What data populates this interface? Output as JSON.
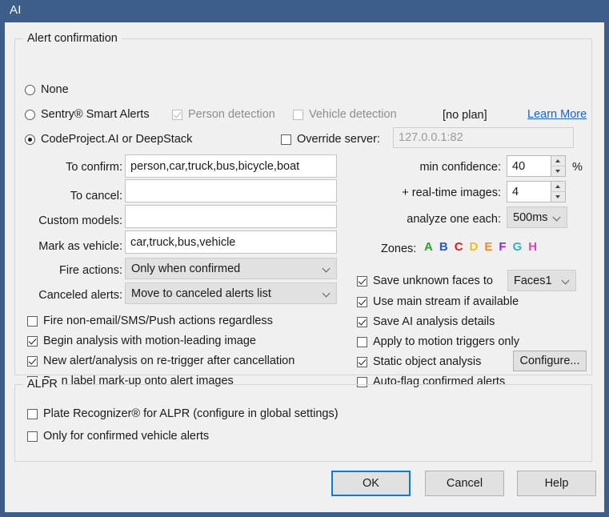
{
  "window": {
    "title": "AI"
  },
  "alert_group": {
    "legend": "Alert confirmation",
    "modes": [
      {
        "label": "None",
        "selected": false
      },
      {
        "label": "Sentry® Smart Alerts",
        "selected": false
      },
      {
        "label": "CodeProject.AI or DeepStack",
        "selected": true
      }
    ],
    "sentry": {
      "person_detection": {
        "label": "Person detection",
        "checked": true,
        "enabled": false
      },
      "vehicle_detection": {
        "label": "Vehicle detection",
        "checked": false,
        "enabled": false
      },
      "plan_status": "[no plan]",
      "learn_more": "Learn More"
    },
    "override_server": {
      "label": "Override server:",
      "checked": false,
      "value": "127.0.0.1:82",
      "enabled": false
    },
    "fields": [
      {
        "label": "To confirm:",
        "value": "person,car,truck,bus,bicycle,boat"
      },
      {
        "label": "To cancel:",
        "value": ""
      },
      {
        "label": "Custom models:",
        "value": ""
      },
      {
        "label": "Mark as vehicle:",
        "value": "car,truck,bus,vehicle"
      }
    ],
    "selects": [
      {
        "label": "Fire actions:",
        "value": "Only when confirmed"
      },
      {
        "label": "Canceled alerts:",
        "value": "Move to canceled alerts list"
      }
    ],
    "spinners": [
      {
        "label": "min confidence:",
        "value": "40",
        "suffix": "%"
      },
      {
        "label": "+ real-time images:",
        "value": "4",
        "suffix": ""
      }
    ],
    "analyze": {
      "label": "analyze one each:",
      "value": "500ms"
    },
    "zones": {
      "label": "Zones:",
      "letters": [
        {
          "letter": "A",
          "color": "#2aa02a"
        },
        {
          "letter": "B",
          "color": "#2a55d4"
        },
        {
          "letter": "C",
          "color": "#e01b1b"
        },
        {
          "letter": "D",
          "color": "#e8c020"
        },
        {
          "letter": "E",
          "color": "#f08a20"
        },
        {
          "letter": "F",
          "color": "#8a2ad4"
        },
        {
          "letter": "G",
          "color": "#2ab8b8"
        },
        {
          "letter": "H",
          "color": "#e040b0"
        }
      ]
    },
    "left_checkboxes": [
      {
        "label": "Fire non-email/SMS/Push actions regardless",
        "checked": false
      },
      {
        "label": "Begin analysis with motion-leading image",
        "checked": true
      },
      {
        "label": "New alert/analysis on re-trigger after cancellation",
        "checked": true
      },
      {
        "label": "Burn label mark-up onto alert images",
        "checked": true
      }
    ],
    "right_checkboxes": [
      {
        "label": "Save unknown faces to",
        "checked": true
      },
      {
        "label": "Use main stream if available",
        "checked": true
      },
      {
        "label": "Save AI analysis details",
        "checked": true
      },
      {
        "label": "Apply to motion triggers only",
        "checked": false
      },
      {
        "label": "Static object analysis",
        "checked": true
      },
      {
        "label": "Auto-flag confirmed alerts",
        "checked": false
      }
    ],
    "faces_select": {
      "value": "Faces1"
    },
    "configure_button": {
      "label": "Configure..."
    }
  },
  "alpr_group": {
    "legend": "ALPR",
    "checkboxes": [
      {
        "label": "Plate Recognizer® for ALPR (configure in global settings)",
        "checked": false
      },
      {
        "label": "Only for confirmed vehicle alerts",
        "checked": false
      }
    ]
  },
  "buttons": {
    "ok": "OK",
    "cancel": "Cancel",
    "help": "Help"
  }
}
